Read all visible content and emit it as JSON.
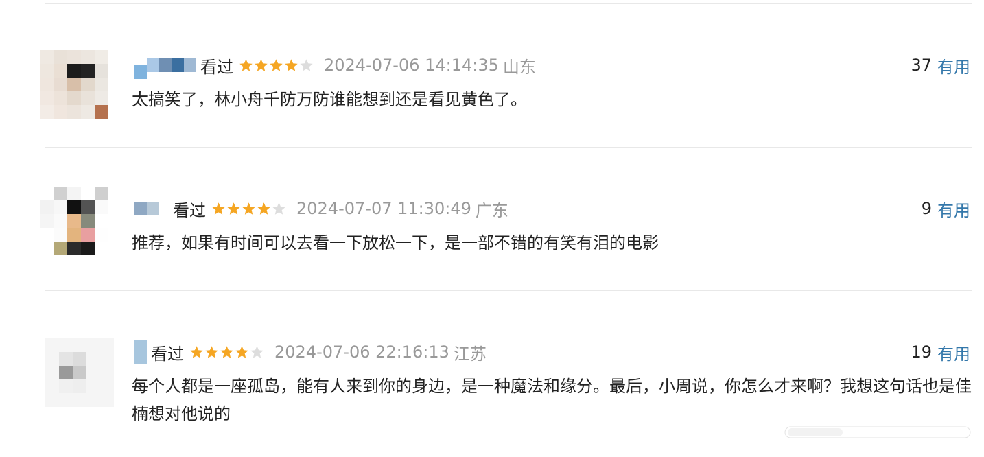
{
  "reviews": [
    {
      "status": "看过",
      "rating": 4,
      "timestamp": "2024-07-06 14:14:35",
      "location": "山东",
      "votes": "37",
      "useful_label": "有用",
      "content": "太搞笑了，林小舟千防万防谁能想到还是看见黄色了。"
    },
    {
      "status": "看过",
      "rating": 4,
      "timestamp": "2024-07-07 11:30:49",
      "location": "广东",
      "votes": "9",
      "useful_label": "有用",
      "content": "推荐，如果有时间可以去看一下放松一下，是一部不错的有笑有泪的电影"
    },
    {
      "status": "看过",
      "rating": 4,
      "timestamp": "2024-07-06 22:16:13",
      "location": "江苏",
      "votes": "19",
      "useful_label": "有用",
      "content": "每个人都是一座孤岛，能有人来到你的身边，是一种魔法和缘分。最后，小周说，你怎么才来啊？我想这句话也是佳楠想对他说的"
    }
  ],
  "colors": {
    "star_filled": "#f5a623",
    "star_empty": "#dddddd",
    "link": "#3377aa",
    "muted": "#999999"
  },
  "icons": {
    "star": "star-icon",
    "avatar": "pixelated-avatar"
  }
}
